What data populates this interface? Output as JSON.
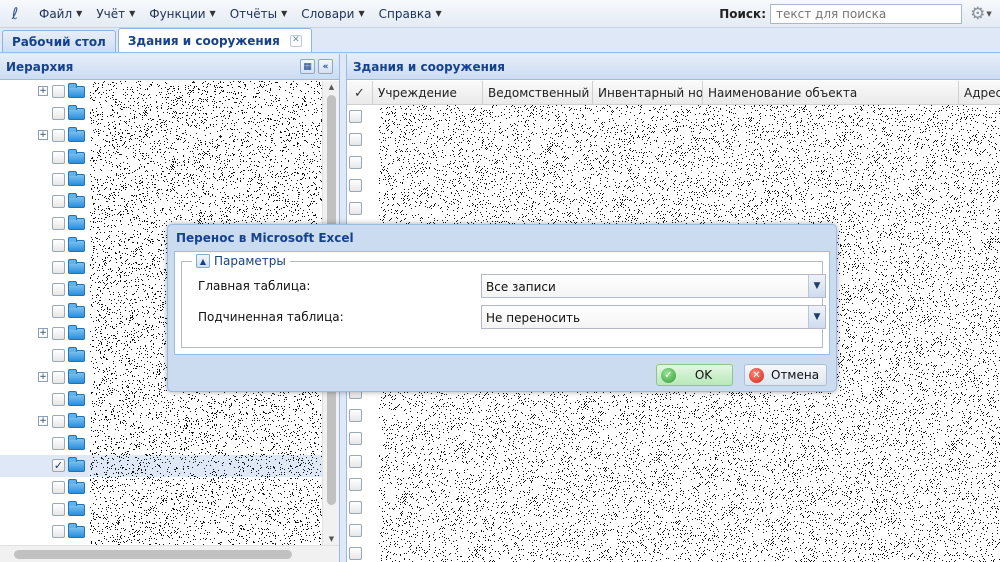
{
  "menu": {
    "items": [
      "Файл",
      "Учёт",
      "Функции",
      "Отчёты",
      "Словари",
      "Справка"
    ],
    "search_label": "Поиск:",
    "search_placeholder": "текст для поиска"
  },
  "tabs": [
    {
      "label": "Рабочий стол",
      "active": false
    },
    {
      "label": "Здания и сооружения",
      "active": true
    }
  ],
  "left_panel": {
    "title": "Иерархия",
    "rows": [
      {
        "expandable": true,
        "checked": false
      },
      {
        "expandable": false,
        "checked": false
      },
      {
        "expandable": true,
        "checked": false
      },
      {
        "expandable": false,
        "checked": false
      },
      {
        "expandable": false,
        "checked": false
      },
      {
        "expandable": false,
        "checked": false
      },
      {
        "expandable": false,
        "checked": false
      },
      {
        "expandable": false,
        "checked": false
      },
      {
        "expandable": false,
        "checked": false
      },
      {
        "expandable": false,
        "checked": false
      },
      {
        "expandable": false,
        "checked": false
      },
      {
        "expandable": true,
        "checked": false
      },
      {
        "expandable": false,
        "checked": false
      },
      {
        "expandable": true,
        "checked": false
      },
      {
        "expandable": false,
        "checked": false
      },
      {
        "expandable": true,
        "checked": false
      },
      {
        "expandable": false,
        "checked": false
      },
      {
        "expandable": false,
        "checked": true,
        "selected": true
      },
      {
        "expandable": false,
        "checked": false
      },
      {
        "expandable": false,
        "checked": false
      },
      {
        "expandable": false,
        "checked": false
      },
      {
        "expandable": false,
        "checked": false
      }
    ]
  },
  "right_panel": {
    "title": "Здания и сооружения",
    "check_header": "✓",
    "columns": [
      "Учреждение",
      "Ведомственный но",
      "Инвентарный номе",
      "Наименование объекта",
      "Адрес"
    ],
    "row_count": 20
  },
  "dialog": {
    "title": "Перенос в Microsoft Excel",
    "section_label": "Параметры",
    "fields": [
      {
        "label": "Главная таблица:",
        "value": "Все записи"
      },
      {
        "label": "Подчиненная таблица:",
        "value": "Не переносить"
      }
    ],
    "ok_label": "OK",
    "cancel_label": "Отмена"
  },
  "colors": {
    "header_text": "#15428b",
    "panel_border": "#99bbe8",
    "ok_green": "#2f9a2f",
    "cancel_red": "#d02314"
  },
  "icons": [
    "logo-icon",
    "gear-icon",
    "tab-close-icon",
    "tree-expand-icon",
    "folder-icon",
    "collapse-icon",
    "toggle-icon",
    "combo-trigger-icon",
    "ok-check-icon",
    "cancel-x-icon"
  ]
}
